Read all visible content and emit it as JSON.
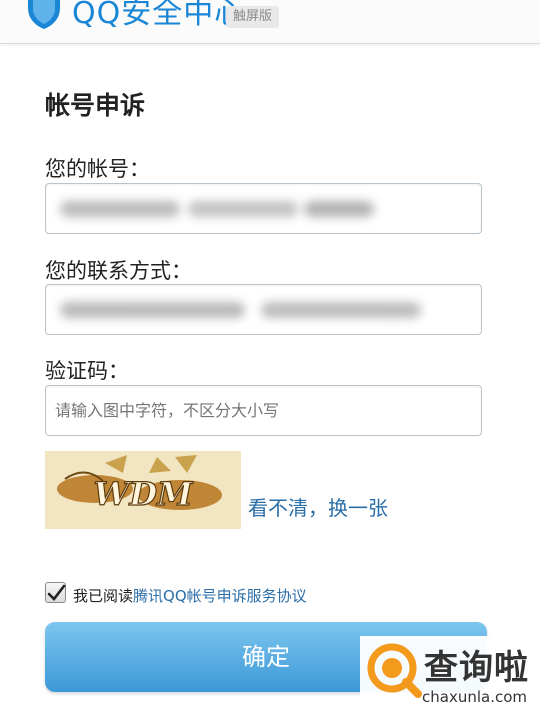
{
  "header": {
    "brand": "QQ安全中心",
    "badge": "触屏版"
  },
  "form": {
    "title": "帐号申诉",
    "account_label": "您的帐号：",
    "contact_label": "您的联系方式：",
    "captcha_label": "验证码：",
    "captcha_placeholder": "请输入图中字符，不区分大小写",
    "captcha_image_text": "WDM",
    "refresh_text": "看不清，换一张",
    "agree_prefix": "我已阅读",
    "agree_link": "腾讯QQ帐号申诉服务协议",
    "agree_checked": true,
    "confirm_label": "确定"
  },
  "watermark": {
    "title": "查询啦",
    "domain": "chaxunla.com"
  },
  "colors": {
    "accent": "#1a86d6",
    "link": "#2a6ea8",
    "button_top": "#7cc6ee",
    "button_bottom": "#3d98d8",
    "watermark_orange": "#f39a1d"
  }
}
